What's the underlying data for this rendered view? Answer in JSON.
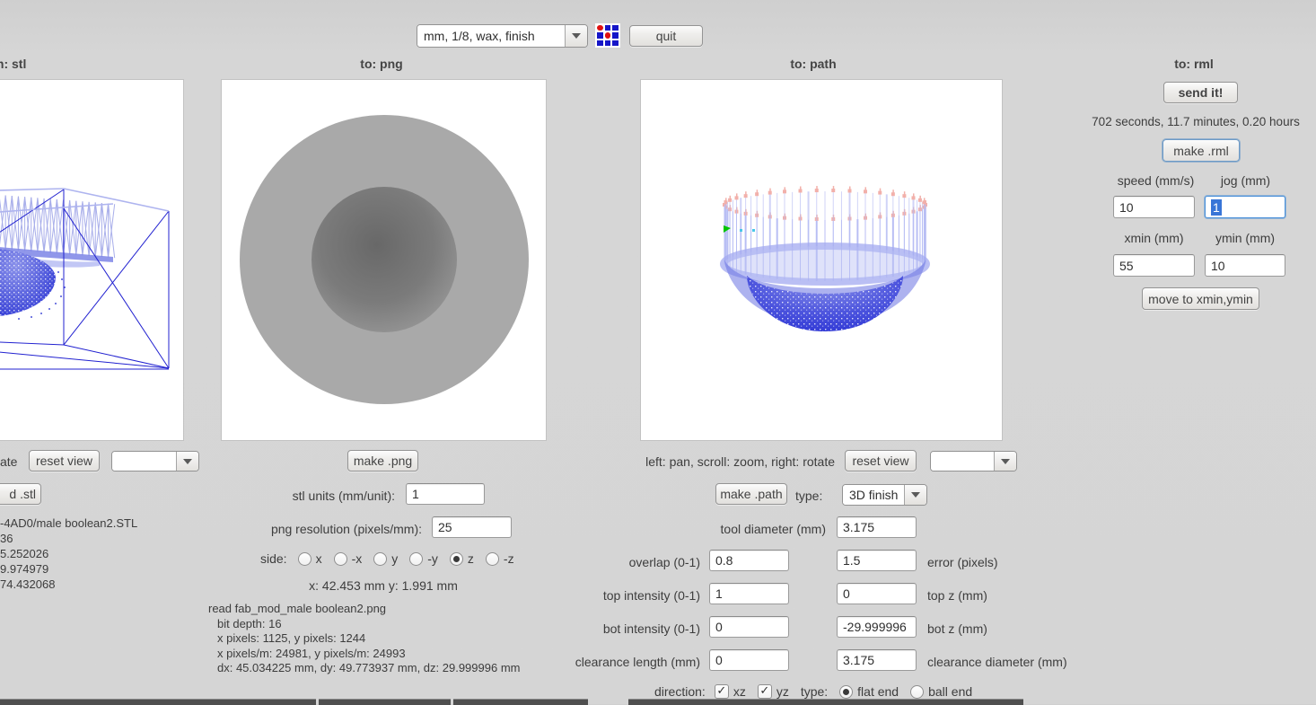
{
  "topbar": {
    "preset_value": "mm, 1/8, wax, finish",
    "quit_label": "quit"
  },
  "headers": {
    "stl": "m: stl",
    "png": "to: png",
    "path": "to: path",
    "rml": "to: rml"
  },
  "stl_column": {
    "hint": "ate",
    "reset_view_label": "reset view",
    "load_button_label": "d .stl",
    "info_lines": {
      "0": "-4AD0/male boolean2.STL",
      "1": "36",
      "2": "5.252026",
      "3": "9.974979",
      "4": "74.432068"
    }
  },
  "png_column": {
    "make_button_label": "make .png",
    "stl_units_label": "stl units (mm/unit):",
    "stl_units_value": "1",
    "resolution_label": "png resolution (pixels/mm):",
    "resolution_value": "25",
    "side_label": "side:",
    "sides": {
      "0": {
        "label": "x",
        "selected": false
      },
      "1": {
        "label": "-x",
        "selected": false
      },
      "2": {
        "label": "y",
        "selected": false
      },
      "3": {
        "label": "-y",
        "selected": false
      },
      "4": {
        "label": "z",
        "selected": true
      },
      "5": {
        "label": "-z",
        "selected": false
      }
    },
    "cursor_readout": "x: 42.453 mm  y: 1.991 mm",
    "info_lines": {
      "0": "read fab_mod_male boolean2.png",
      "1": "bit depth: 16",
      "2": "x pixels: 1125, y pixels: 1244",
      "3": "x pixels/m: 24981, y pixels/m: 24993",
      "4": "dx: 45.034225 mm, dy: 49.773937 mm, dz: 29.999996 mm"
    }
  },
  "path_column": {
    "hint": "left: pan, scroll: zoom, right: rotate",
    "reset_view_label": "reset view",
    "make_button_label": "make .path",
    "type_label": "type:",
    "type_value": "3D finish",
    "rows": {
      "0": {
        "label": "tool diameter (mm)",
        "value": "3.175"
      },
      "1": {
        "label": "overlap (0-1)",
        "value": "0.8",
        "value2": "1.5",
        "label2": "error (pixels)"
      },
      "2": {
        "label": "top intensity (0-1)",
        "value": "1",
        "value2": "0",
        "label2": "top z (mm)"
      },
      "3": {
        "label": "bot intensity (0-1)",
        "value": "0",
        "value2": "-29.999996",
        "label2": "bot z (mm)"
      },
      "4": {
        "label": "clearance length (mm)",
        "value": "0",
        "value2": "3.175",
        "label2": "clearance diameter (mm)"
      }
    },
    "direction_label": "direction:",
    "direction_checks": {
      "0": {
        "label": "xz",
        "checked": true
      },
      "1": {
        "label": "yz",
        "checked": true
      }
    },
    "end_type_label": "type:",
    "end_radios": {
      "0": {
        "label": "flat end",
        "selected": true
      },
      "1": {
        "label": "ball end",
        "selected": false
      }
    }
  },
  "rml_column": {
    "send_button_label": "send it!",
    "time_text": "702 seconds, 11.7 minutes, 0.20 hours",
    "make_button_label": "make .rml",
    "speed_label": "speed (mm/s)",
    "jog_label": "jog (mm)",
    "speed_value": "10",
    "jog_value": "1",
    "xmin_label": "xmin (mm)",
    "ymin_label": "ymin (mm)",
    "xmin_value": "55",
    "ymin_value": "10",
    "move_button_label": "move to xmin,ymin"
  },
  "colors": {
    "wireframe_blue": "#2121d0",
    "mesh_lavender": "#a8aeea",
    "path_line_lavender": "#b7bdf4",
    "path_dot_pink": "#f2b0aa",
    "bowl_blue_deep": "#2d35d4",
    "bowl_blue_light": "#8289e8",
    "origin_green": "#00c400",
    "selection_blue": "#3875d7",
    "fab_icon_blue": "#1515c8",
    "fab_icon_red": "#e01010",
    "png_outer_gray": "#a9a9a9",
    "png_inner_dark": "#686868"
  }
}
